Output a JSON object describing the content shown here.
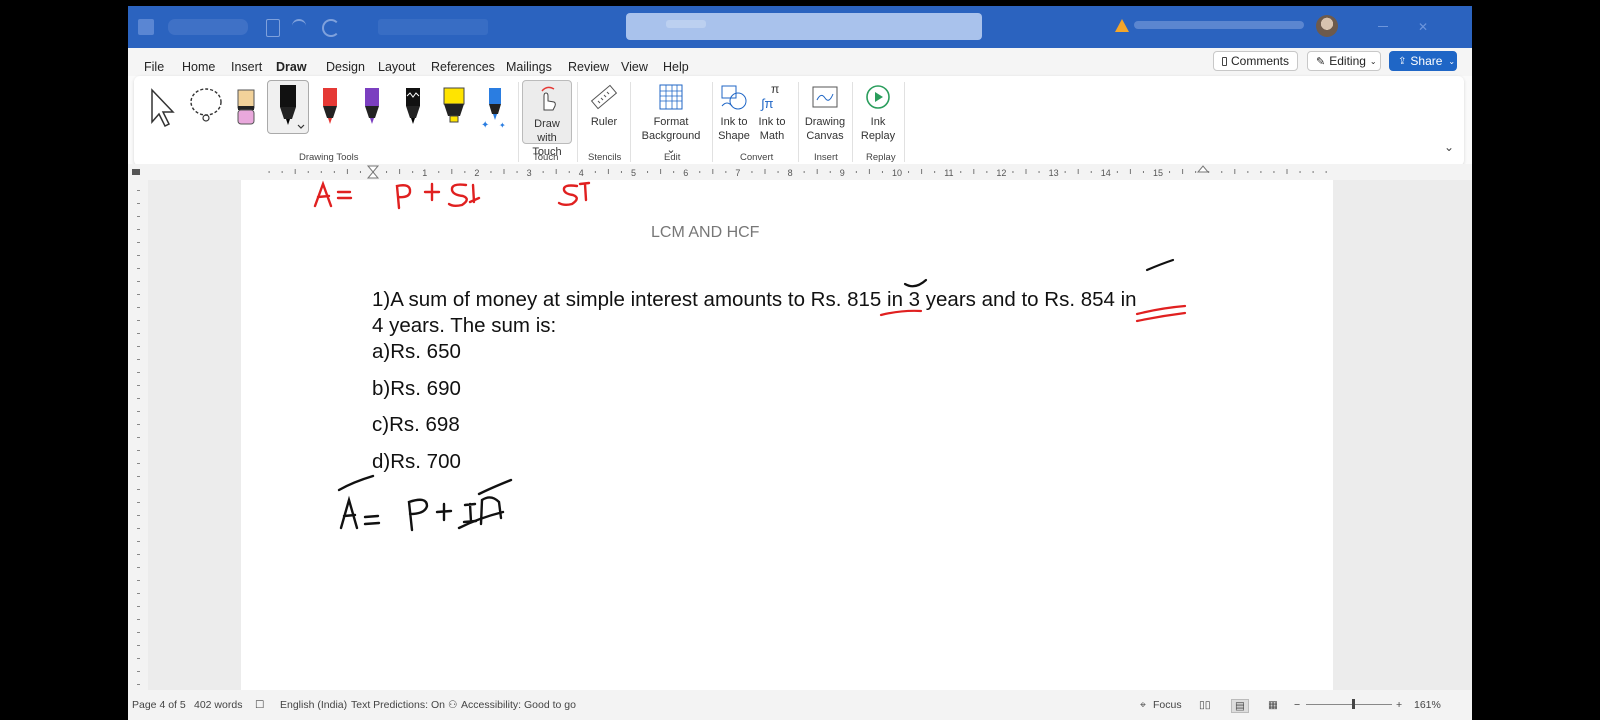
{
  "menu": {
    "tabs": [
      "File",
      "Home",
      "Insert",
      "Draw",
      "Design",
      "Layout",
      "References",
      "Mailings",
      "Review",
      "View",
      "Help"
    ],
    "active": "Draw",
    "comments": "Comments",
    "editing": "Editing",
    "share": "Share"
  },
  "ribbon": {
    "draw_with_touch": "Draw with Touch",
    "ruler": "Ruler",
    "format_background": "Format Background",
    "ink_to_shape": "Ink to Shape",
    "ink_to_math": "Ink to Math",
    "drawing_canvas": "Drawing Canvas",
    "ink_replay": "Ink Replay",
    "groups": {
      "drawing_tools": "Drawing Tools",
      "touch": "Touch",
      "stencils": "Stencils",
      "edit": "Edit",
      "convert": "Convert",
      "insert": "Insert",
      "replay": "Replay"
    }
  },
  "document": {
    "title": "LCM AND HCF",
    "question_line1": "1)A sum of money at simple interest amounts to Rs. 815 in 3 years and to Rs. 854 in",
    "question_line2": "4 years. The sum is:",
    "options": [
      "a)Rs. 650",
      "b)Rs. 690",
      "c)Rs. 698",
      "d)Rs. 700"
    ],
    "ink_top": "A = P + SI     SI",
    "ink_bottom": "A = P + I n"
  },
  "status": {
    "page": "Page 4 of 5",
    "words": "402 words",
    "language": "English (India)",
    "text_predictions": "Text Predictions: On",
    "accessibility": "Accessibility: Good to go",
    "focus": "Focus",
    "zoom": "161%"
  },
  "colors": {
    "titlebar": "#2b63bf",
    "accent": "#1f66c6",
    "ink_red": "#e02020"
  }
}
